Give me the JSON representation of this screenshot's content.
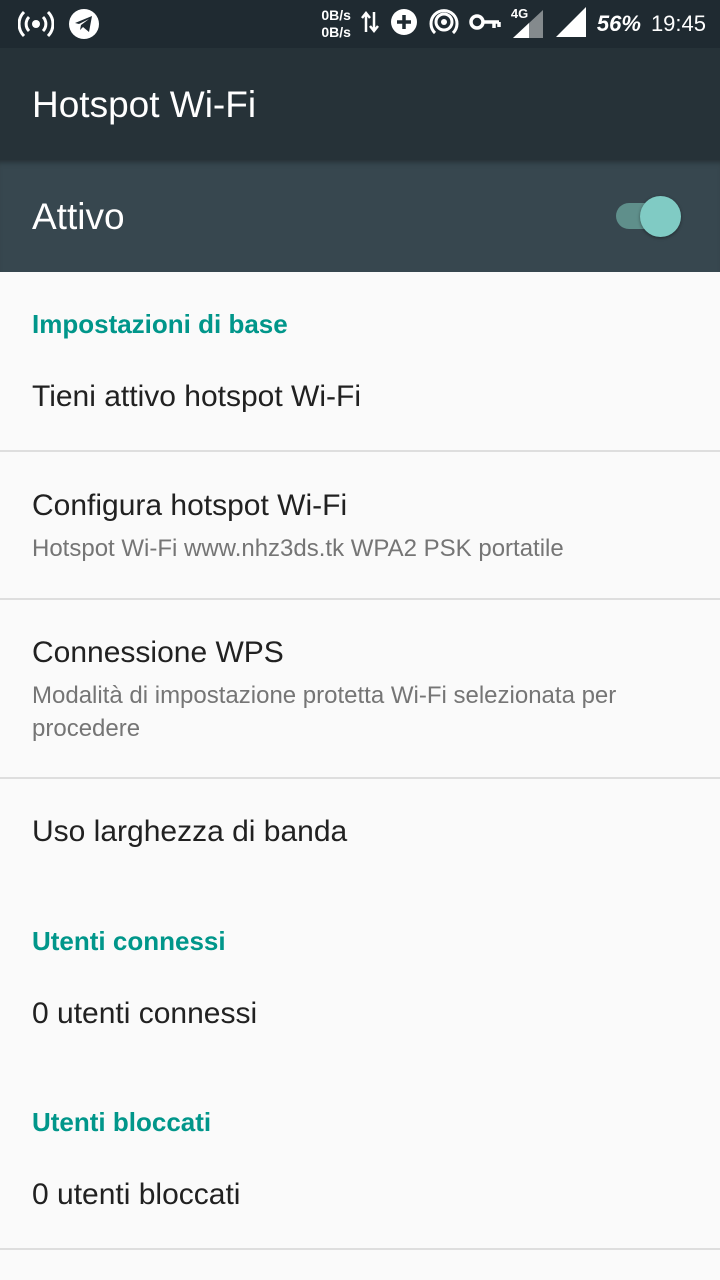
{
  "status_bar": {
    "speed_up": "0B/s",
    "speed_down": "0B/s",
    "network_type": "4G",
    "battery": "56%",
    "time": "19:45",
    "icons": [
      "hotspot-icon",
      "telegram-icon",
      "data-transfer-icon",
      "data-saver-icon",
      "portable-hotspot-icon",
      "vpn-key-icon",
      "signal-4g-icon",
      "signal-icon"
    ]
  },
  "header": {
    "title": "Hotspot Wi-Fi"
  },
  "master_switch": {
    "label": "Attivo",
    "state": "on",
    "accent_color": "#80cbc4"
  },
  "sections": {
    "basic": {
      "header": "Impostazioni di base",
      "keep_active": {
        "title": "Tieni attivo hotspot Wi-Fi"
      },
      "configure": {
        "title": "Configura hotspot Wi-Fi",
        "summary": "Hotspot Wi-Fi www.nhz3ds.tk WPA2 PSK portatile"
      },
      "wps": {
        "title": "Connessione WPS",
        "summary": "Modalità di impostazione protetta Wi-Fi selezionata per procedere"
      },
      "bandwidth": {
        "title": "Uso larghezza di banda"
      }
    },
    "connected": {
      "header": "Utenti connessi",
      "count": "0 utenti connessi"
    },
    "blocked": {
      "header": "Utenti bloccati",
      "count": "0 utenti bloccati"
    }
  },
  "colors": {
    "status_bar": "#1f2a31",
    "app_bar": "#263238",
    "master_bar": "#37474f",
    "accent": "#00968a"
  }
}
